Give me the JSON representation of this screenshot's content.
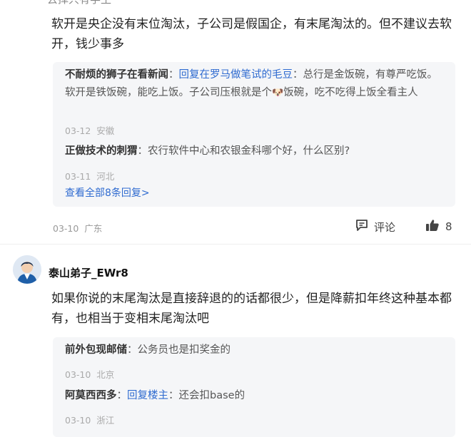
{
  "top_cut_text": "去掉只有学生",
  "comment1": {
    "text": "软开是央企没有末位淘汰，子公司是假国企，有末尾淘汰的。但不建议去软开，钱少事多",
    "replies": [
      {
        "name": "不耐烦的狮子在看新闻",
        "reply_to": "回复在罗马做笔试的毛豆",
        "text_before_emoji": "总行是金饭碗，有尊严吃饭。软开是铁饭碗，能吃上饭。子公司压根就是个",
        "emoji": "🐶",
        "text_after_emoji": "饭碗，吃不吃得上饭全看主人",
        "date": "03-12",
        "location": "安徽"
      },
      {
        "name": "正做技术的刺猬",
        "text": "农行软件中心和农银金科哪个好，什么区别?",
        "date": "03-11",
        "location": "河北"
      }
    ],
    "view_all": "查看全部8条回复>",
    "date": "03-10",
    "location": "广东",
    "comment_label": "评论",
    "like_count": "8"
  },
  "comment2": {
    "username": "泰山弟子_EWr8",
    "text": "如果你说的末尾淘汰是直接辞退的的话都很少，但是降薪扣年终这种基本都有，也相当于变相末尾淘汰吧",
    "replies": [
      {
        "name": "前外包现邮储",
        "text": "公务员也是扣奖金的",
        "date": "03-10",
        "location": "北京"
      },
      {
        "name": "阿莫西西多",
        "reply_to": "回复楼主",
        "text": "还会扣base的",
        "date": "03-10",
        "location": "浙江"
      }
    ]
  },
  "colors": {
    "link": "#2f6bd0",
    "reply_bg": "#f5f6f8"
  }
}
